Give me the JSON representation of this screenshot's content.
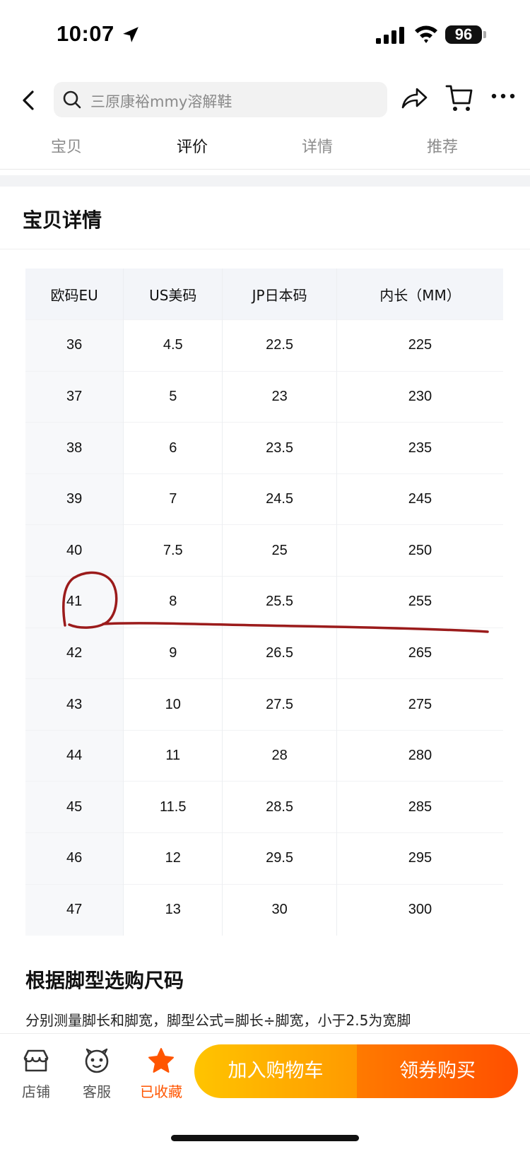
{
  "status_bar": {
    "time": "10:07",
    "battery": "96"
  },
  "nav": {
    "search_placeholder": "三原康裕mmy溶解鞋"
  },
  "tabs": [
    {
      "label": "宝贝",
      "active": false
    },
    {
      "label": "评价",
      "active": true
    },
    {
      "label": "详情",
      "active": false
    },
    {
      "label": "推荐",
      "active": false
    }
  ],
  "section": {
    "title": "宝贝详情"
  },
  "size_table": {
    "headers": [
      "欧码EU",
      "US美码",
      "JP日本码",
      "内长（MM）"
    ],
    "rows": [
      [
        "36",
        "4.5",
        "22.5",
        "225"
      ],
      [
        "37",
        "5",
        "23",
        "230"
      ],
      [
        "38",
        "6",
        "23.5",
        "235"
      ],
      [
        "39",
        "7",
        "24.5",
        "245"
      ],
      [
        "40",
        "7.5",
        "25",
        "250"
      ],
      [
        "41",
        "8",
        "25.5",
        "255"
      ],
      [
        "42",
        "9",
        "26.5",
        "265"
      ],
      [
        "43",
        "10",
        "27.5",
        "275"
      ],
      [
        "44",
        "11",
        "28",
        "280"
      ],
      [
        "45",
        "11.5",
        "28.5",
        "285"
      ],
      [
        "46",
        "12",
        "29.5",
        "295"
      ],
      [
        "47",
        "13",
        "30",
        "300"
      ]
    ],
    "highlighted_size": "41"
  },
  "guide": {
    "title": "根据脚型选购尺码",
    "text": "分别测量脚长和脚宽，脚型公式=脚长÷脚宽，小于2.5为宽脚"
  },
  "bottom_bar": {
    "store_label": "店铺",
    "service_label": "客服",
    "favorite_label": "已收藏",
    "add_to_cart_label": "加入购物车",
    "buy_label": "领券购买"
  },
  "colors": {
    "accent": "#ff5500",
    "annotation": "#9b1b1b"
  }
}
